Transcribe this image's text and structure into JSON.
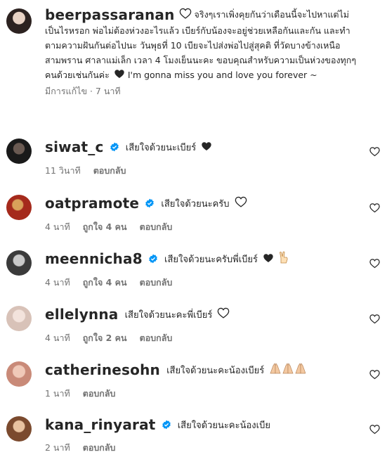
{
  "caption": {
    "username": "beerpassaranan",
    "text": "จริงๆเราเพิ่งคุยกันว่าเดือนนี้จะไปหาแต่ไม่เป็นไรหรอก พ่อไม่ต้องห่วงอะไรแล้ว เบียร์กับน้องจะอยู่ช่วยเหลือกันและกัน และทำตามความฝันกันต่อไปนะ วันพุธที่ 10 เบียจะไปส่งพ่อไปสู่สุคติ ที่วัดบางข้างเหนือ สามพราน ศาลาแม่เล็ก เวลา 4 โมงเย็นนะคะ ขอบคุณสำหรับความเป็นห่วงของทุกๆคนด้วยเช่นกันค่ะ",
    "text_end": "I'm gonna miss you and love you forever ~",
    "edited": "มีการแก้ไข",
    "time": "7 นาที"
  },
  "reply_label": "ตอบกลับ",
  "comments": [
    {
      "username": "siwat_c",
      "verified": true,
      "text": "เสียใจด้วยนะเบียร์",
      "time": "11 วินาที",
      "likes": ""
    },
    {
      "username": "oatpramote",
      "verified": true,
      "text": "เสียใจด้วยนะครับ",
      "time": "4 นาที",
      "likes": "ถูกใจ 4 คน"
    },
    {
      "username": "meennicha8",
      "verified": true,
      "text": "เสียใจด้วยนะครับพี่เบียร์",
      "time": "4 นาที",
      "likes": "ถูกใจ 4 คน"
    },
    {
      "username": "ellelynna",
      "verified": false,
      "text": "เสียใจด้วยนะคะพี่เบียร์",
      "time": "4 นาที",
      "likes": "ถูกใจ 2 คน"
    },
    {
      "username": "catherinesohn",
      "verified": false,
      "text": "เสียใจด้วยนะคะน้องเบียร์",
      "time": "1 นาที",
      "likes": ""
    },
    {
      "username": "kana_rinyarat",
      "verified": true,
      "text": "เสียใจด้วยนะคะน้องเบีย",
      "time": "2 นาที",
      "likes": ""
    }
  ],
  "colors": {
    "verified": "#0095f6",
    "meta": "#737373",
    "text": "#262626"
  }
}
